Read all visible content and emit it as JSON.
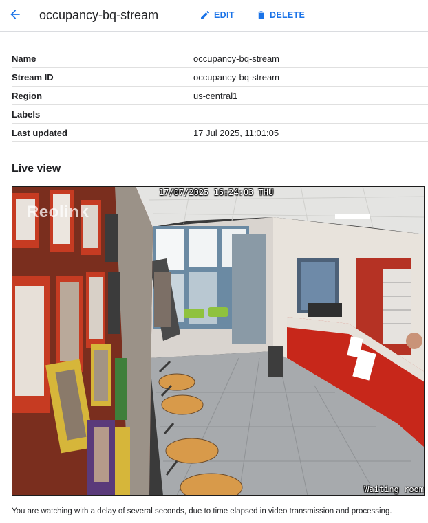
{
  "header": {
    "title": "occupancy-bq-stream",
    "edit_label": "EDIT",
    "delete_label": "DELETE",
    "accent_color": "#1a73e8"
  },
  "details": [
    {
      "key": "Name",
      "value": "occupancy-bq-stream"
    },
    {
      "key": "Stream ID",
      "value": "occupancy-bq-stream"
    },
    {
      "key": "Region",
      "value": "us-central1"
    },
    {
      "key": "Labels",
      "value": "—"
    },
    {
      "key": "Last updated",
      "value": "17 Jul 2025, 11:01:05"
    }
  ],
  "live_view": {
    "title": "Live view",
    "osd_timestamp": "17/07/2025 16:24:03 THU",
    "osd_camera_label": "Waiting room",
    "watermark": "Reolink",
    "caption": "You are watching with a delay of several seconds, due to time elapsed in video transmission and processing."
  }
}
